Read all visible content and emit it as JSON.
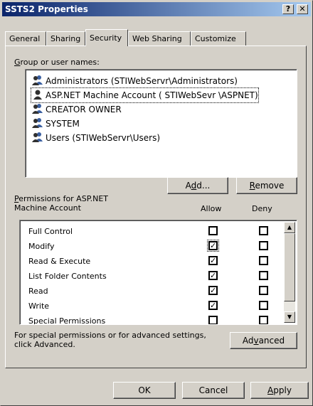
{
  "window": {
    "title": "SSTS2 Properties",
    "help_label": "?",
    "close_label": "✕"
  },
  "tabs": [
    {
      "label": "General",
      "active": false
    },
    {
      "label": "Sharing",
      "active": false
    },
    {
      "label": "Security",
      "active": true
    },
    {
      "label": "Web Sharing",
      "active": false
    },
    {
      "label": "Customize",
      "active": false
    }
  ],
  "group_section": {
    "label_accel": "G",
    "label_rest": "roup or user names:",
    "users": [
      {
        "name": "Administrators (STIWebServr\\Administrators)",
        "icon": "group-icon",
        "selected": false
      },
      {
        "name": "ASP.NET Machine Account ( STIWebSevr \\ASPNET)",
        "icon": "user-icon",
        "selected": true
      },
      {
        "name": "CREATOR OWNER",
        "icon": "group-icon",
        "selected": false
      },
      {
        "name": "SYSTEM",
        "icon": "group-icon",
        "selected": false
      },
      {
        "name": "Users (STIWebServr\\Users)",
        "icon": "group-icon",
        "selected": false
      }
    ],
    "add_pre": "A",
    "add_accel": "d",
    "add_post": "d...",
    "remove_accel": "R",
    "remove_rest": "emove"
  },
  "permissions": {
    "header_accel": "P",
    "header_line1_rest": "ermissions for ASP.NET",
    "header_line2": "Machine Account",
    "allow_label": "Allow",
    "deny_label": "Deny",
    "rows": [
      {
        "name": "Full Control",
        "allow": false,
        "deny": false
      },
      {
        "name": "Modify",
        "allow": true,
        "deny": false
      },
      {
        "name": "Read & Execute",
        "allow": true,
        "deny": false
      },
      {
        "name": "List Folder Contents",
        "allow": true,
        "deny": false
      },
      {
        "name": "Read",
        "allow": true,
        "deny": false
      },
      {
        "name": "Write",
        "allow": true,
        "deny": false
      },
      {
        "name": "Special Permissions",
        "allow": false,
        "deny": false
      }
    ]
  },
  "advanced": {
    "text_line1": "For special permissions or for advanced settings,",
    "text_line2": "click Advanced.",
    "button_pre": "Ad",
    "button_accel": "v",
    "button_post": "anced"
  },
  "footer": {
    "ok_label": "OK",
    "cancel_label": "Cancel",
    "apply_accel": "A",
    "apply_rest": "pply"
  }
}
